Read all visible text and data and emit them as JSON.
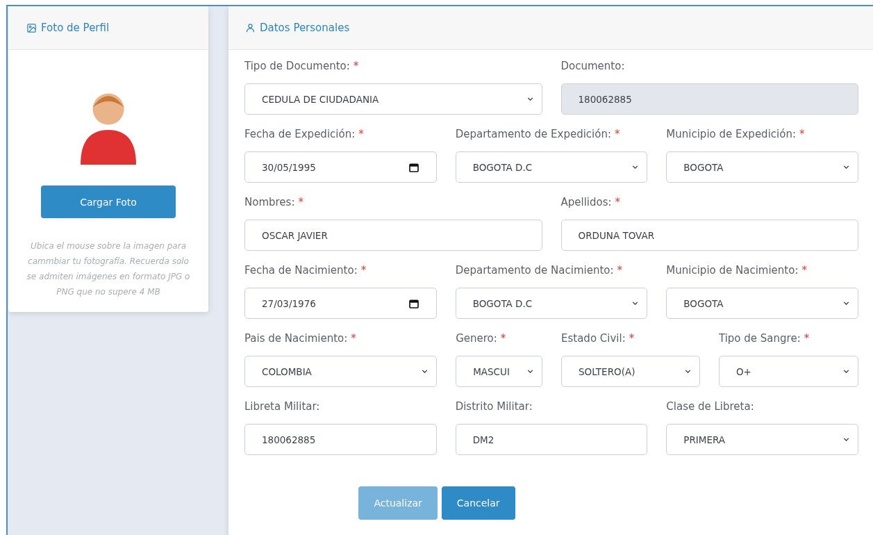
{
  "profile_photo": {
    "title": "Foto de Perfil",
    "upload_button": "Cargar Foto",
    "help_text": "Ubica el mouse sobre la imagen para cammbiar tu fotografía. Recuerda solo se admiten imágenes en formato JPG o PNG que no supere 4 MB"
  },
  "personal_data": {
    "title": "Datos Personales",
    "form_lines": [
      [
        {
          "label": "Tipo de Documento:",
          "required_mark": "*",
          "kind": "select",
          "value": "CEDULA DE CIUDADANIA",
          "disabled": false
        },
        {
          "label": "Documento:",
          "kind": "text",
          "value": "180062885",
          "disabled": true
        }
      ],
      [
        {
          "label": "Fecha de Expedición:",
          "required_mark": "*",
          "kind": "date",
          "value": "30/05/1995",
          "disabled": false
        },
        {
          "label": "Departamento de Expedición:",
          "required_mark": "*",
          "kind": "select",
          "value": "BOGOTA D.C",
          "disabled": false
        },
        {
          "label": "Municipio de Expedición:",
          "required_mark": "*",
          "kind": "select",
          "value": "BOGOTA",
          "disabled": false
        }
      ],
      [
        {
          "label": "Nombres:",
          "required_mark": "*",
          "kind": "text",
          "value": "OSCAR JAVIER",
          "disabled": false
        },
        {
          "label": "Apellidos:",
          "required_mark": "*",
          "kind": "text",
          "value": "ORDUNA TOVAR",
          "disabled": false
        }
      ],
      [
        {
          "label": "Fecha de Nacimiento:",
          "required_mark": "*",
          "kind": "date",
          "value": "27/03/1976",
          "disabled": false
        },
        {
          "label": "Departamento de Nacimiento:",
          "required_mark": "*",
          "kind": "select",
          "value": "BOGOTA D.C",
          "disabled": false
        },
        {
          "label": "Municipio de Nacimiento:",
          "required_mark": "*",
          "kind": "select",
          "value": "BOGOTA",
          "disabled": false
        }
      ],
      [
        {
          "label": "Pais de Nacimiento:",
          "required_mark": "*",
          "kind": "select",
          "value": "COLOMBIA",
          "disabled": false
        },
        {
          "label": "Genero:",
          "required_mark": "*",
          "kind": "select",
          "value": "MASCUI",
          "disabled": false
        },
        {
          "label": "Estado Civil:",
          "required_mark": "*",
          "kind": "select",
          "value": "SOLTERO(A)",
          "disabled": false
        },
        {
          "label": "Tipo de Sangre:",
          "required_mark": "*",
          "kind": "select",
          "value": "O+",
          "disabled": false
        }
      ],
      [
        {
          "label": "Libreta Militar:",
          "kind": "text",
          "value": "180062885",
          "disabled": false
        },
        {
          "label": "Distrito Militar:",
          "kind": "text",
          "value": "DM2",
          "disabled": false
        },
        {
          "label": "Clase de Libreta:",
          "kind": "select",
          "value": "PRIMERA",
          "disabled": false
        }
      ]
    ],
    "buttons": [
      {
        "label": "Actualizar",
        "disabled": true
      },
      {
        "label": "Cancelar",
        "disabled": false
      }
    ]
  }
}
